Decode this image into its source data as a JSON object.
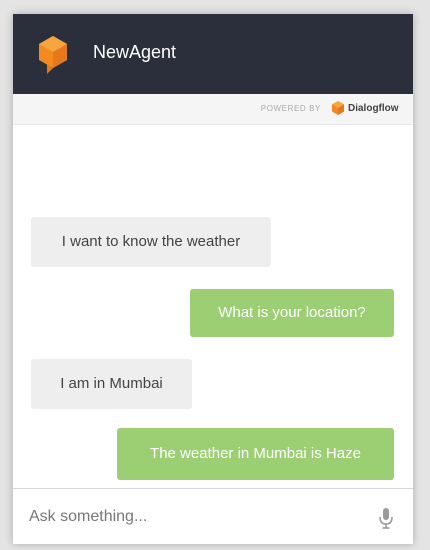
{
  "header": {
    "agent_name": "NewAgent",
    "logo_icon": "dialogflow-cube-icon",
    "background_color": "#2b2f3b",
    "logo_color": "#f59a23"
  },
  "powered": {
    "label": "POWERED BY",
    "brand": "Dialogflow",
    "brand_icon": "dialogflow-cube-icon"
  },
  "messages": [
    {
      "sender": "user",
      "text": "I want to know the weather"
    },
    {
      "sender": "bot",
      "text": "What is your location?"
    },
    {
      "sender": "user",
      "text": "I am in Mumbai"
    },
    {
      "sender": "bot",
      "text": "The weather in Mumbai is Haze"
    }
  ],
  "colors": {
    "user_bubble": "#eeeeef",
    "bot_bubble": "#9ccf74"
  },
  "input": {
    "placeholder": "Ask something...",
    "value": "",
    "mic_icon": "microphone-icon"
  }
}
